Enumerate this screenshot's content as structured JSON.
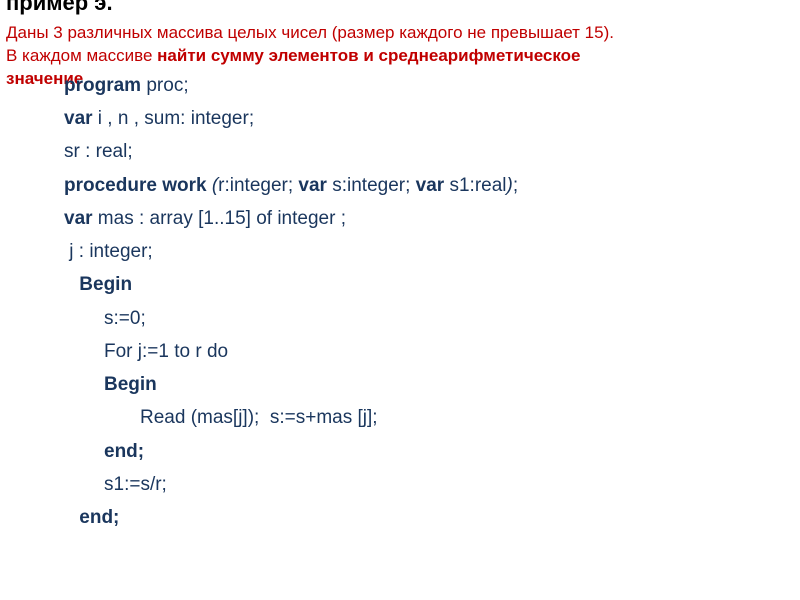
{
  "header": {
    "title_cut": "пример э."
  },
  "task": {
    "line1": "Даны 3 различных массива целых чисел (размер каждого не превышает 15).",
    "line2_a": "В каждом массиве ",
    "line2_b": "найти сумму элементов и среднеарифметическое",
    "line3": "значение"
  },
  "code": {
    "l1_a": "program",
    "l1_b": " proc;",
    "l2_a": "var",
    "l2_b": " i , n , sum: integer;",
    "l3": "sr : real;",
    "l4_a": "procedure work ",
    "l4_b": "(",
    "l4_c": "r:integer; ",
    "l4_d": "var",
    "l4_e": " s:integer; ",
    "l4_f": "var",
    "l4_g": " s1:real",
    "l4_h": ")",
    "l4_i": ";",
    "l5_a": "var",
    "l5_b": " mas : array [1..15] of integer ;",
    "l6": " j : integer;",
    "l7": " Begin",
    "l8": "s:=0;",
    "l9": "For j:=1 to r do",
    "l10": "Begin",
    "l11": "Read (mas[j]);  s:=s+mas [j];",
    "l12": "end;",
    "l13": "s1:=s/r;",
    "l14": " end;"
  }
}
